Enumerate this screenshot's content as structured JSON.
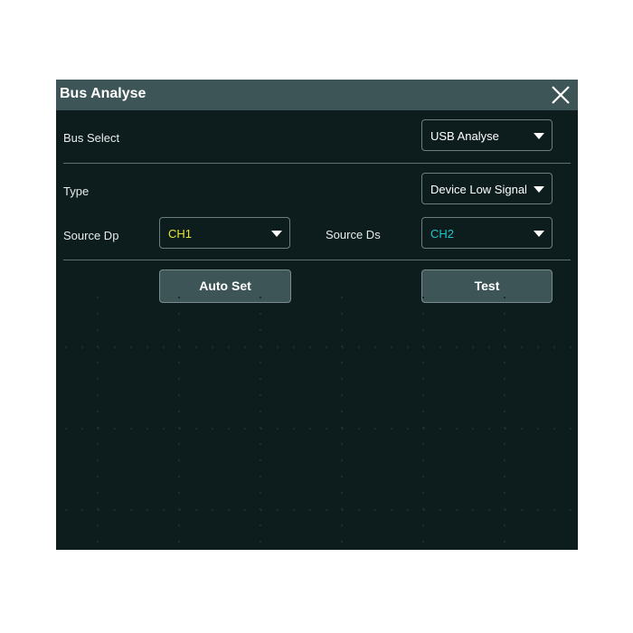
{
  "dialog": {
    "title": "Bus Analyse",
    "close_icon": "close-icon"
  },
  "bus_select": {
    "label": "Bus Select",
    "value": "USB Analyse"
  },
  "type": {
    "label": "Type",
    "value": "Device Low Signal"
  },
  "source_dp": {
    "label": "Source Dp",
    "value": "CH1",
    "color": "#e6e23a"
  },
  "source_ds": {
    "label": "Source Ds",
    "value": "CH2",
    "color": "#21c4c9"
  },
  "buttons": {
    "auto_set": "Auto Set",
    "test": "Test"
  },
  "colors": {
    "background": "#0d1c1d",
    "titlebar": "#3d5556",
    "button": "#3d5556"
  }
}
